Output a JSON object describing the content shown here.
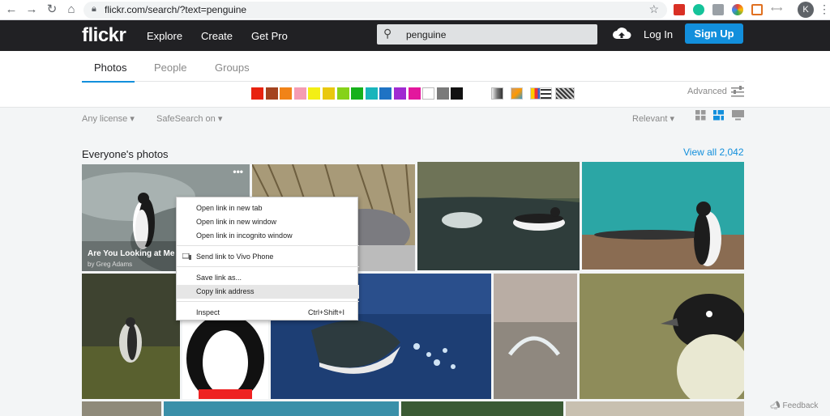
{
  "browser": {
    "url": "flickr.com/search/?text=penguine",
    "profile_initial": "K"
  },
  "header": {
    "logo": "flickr",
    "nav": [
      "Explore",
      "Create",
      "Get Pro"
    ],
    "search_query": "penguine",
    "login": "Log In",
    "signup": "Sign Up"
  },
  "tabs": [
    "Photos",
    "People",
    "Groups"
  ],
  "color_swatches": [
    "#e8220f",
    "#a4431f",
    "#f18318",
    "#f59cb3",
    "#f3ef15",
    "#e9c80e",
    "#86d219",
    "#17b11b",
    "#19b5bb",
    "#1f73c4",
    "#a02ad1",
    "#e3179d",
    "#ffffff",
    "#7a7a7a",
    "#111111"
  ],
  "advanced": "Advanced",
  "filters": {
    "license": "Any license",
    "safesearch": "SafeSearch on",
    "sort": "Relevant"
  },
  "section": {
    "title": "Everyone's photos",
    "view_all": "View all 2,042"
  },
  "first_photo": {
    "title": "Are You Looking at Me",
    "author": "by Greg Adams",
    "more": "•••"
  },
  "context_menu": {
    "items": [
      {
        "label": "Open link in new tab"
      },
      {
        "label": "Open link in new window"
      },
      {
        "label": "Open link in incognito window"
      },
      {
        "label": "Send link to Vivo Phone"
      },
      {
        "label": "Save link as..."
      },
      {
        "label": "Copy link address"
      },
      {
        "label": "Inspect",
        "shortcut": "Ctrl+Shift+I"
      }
    ]
  },
  "feedback": "Feedback"
}
